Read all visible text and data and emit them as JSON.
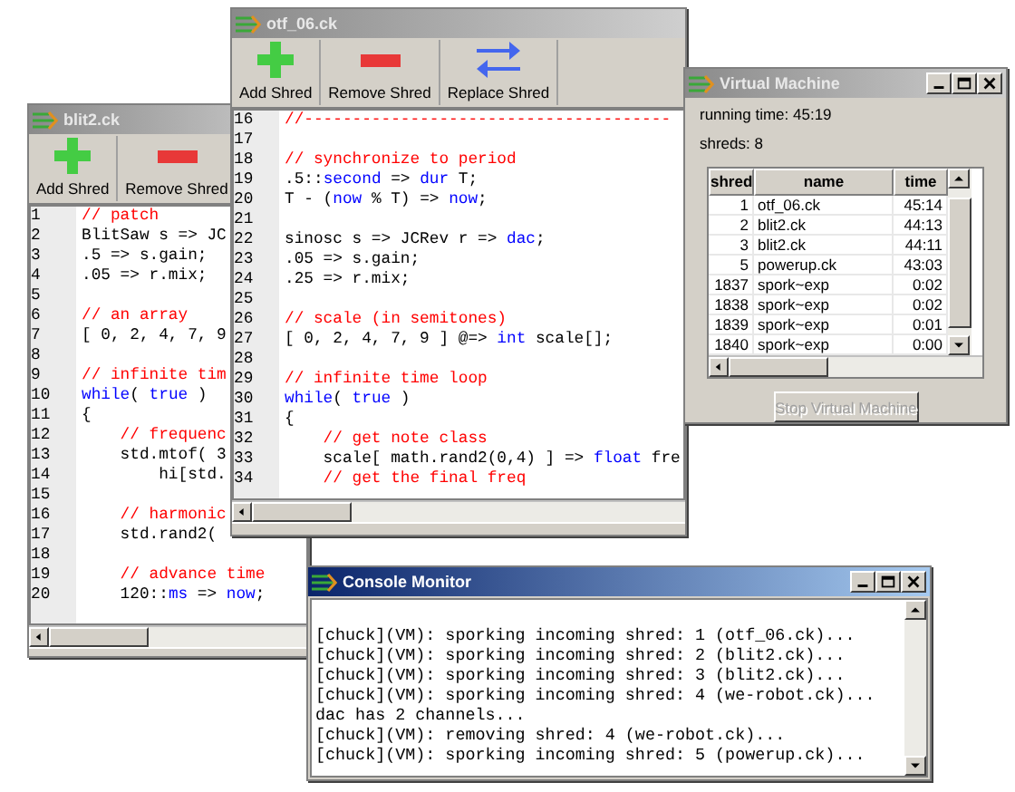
{
  "editor_windows": [
    {
      "title": "blit2.ck",
      "active": false,
      "toolbar": [
        {
          "label": "Add Shred",
          "kind": "add"
        },
        {
          "label": "Remove Shred",
          "kind": "remove"
        }
      ],
      "lines": [
        {
          "num": "1",
          "tokens": [
            {
              "text": "// patch",
              "kind": "comment"
            }
          ]
        },
        {
          "num": "2",
          "tokens": [
            {
              "text": "BlitSaw s => JC",
              "kind": "plain"
            }
          ]
        },
        {
          "num": "3",
          "tokens": [
            {
              "text": ".5 => s.gain;",
              "kind": "plain"
            }
          ]
        },
        {
          "num": "4",
          "tokens": [
            {
              "text": ".05 => r.mix;",
              "kind": "plain"
            }
          ]
        },
        {
          "num": "5"
        },
        {
          "num": "6",
          "tokens": [
            {
              "text": "// an array",
              "kind": "comment"
            }
          ]
        },
        {
          "num": "7",
          "tokens": [
            {
              "text": "[ 0, 2, 4, 7, 9",
              "kind": "plain"
            }
          ]
        },
        {
          "num": "8"
        },
        {
          "num": "9",
          "tokens": [
            {
              "text": "// infinite tim",
              "kind": "comment"
            }
          ]
        },
        {
          "num": "10",
          "tokens": [
            {
              "text": "while",
              "kind": "keyword"
            },
            {
              "text": "( ",
              "kind": "plain"
            },
            {
              "text": "true",
              "kind": "keyword"
            },
            {
              "text": " )",
              "kind": "plain"
            }
          ]
        },
        {
          "num": "11",
          "tokens": [
            {
              "text": "{",
              "kind": "plain"
            }
          ]
        },
        {
          "num": "12",
          "tokens": [
            {
              "text": "    // frequenc",
              "kind": "comment"
            }
          ]
        },
        {
          "num": "13",
          "tokens": [
            {
              "text": "    std.mtof( 3",
              "kind": "plain"
            }
          ]
        },
        {
          "num": "14",
          "tokens": [
            {
              "text": "        hi[std.",
              "kind": "plain"
            }
          ]
        },
        {
          "num": "15"
        },
        {
          "num": "16",
          "tokens": [
            {
              "text": "    // harmonic",
              "kind": "comment"
            }
          ]
        },
        {
          "num": "17",
          "tokens": [
            {
              "text": "    std.rand2(",
              "kind": "plain"
            }
          ]
        },
        {
          "num": "18"
        },
        {
          "num": "19",
          "tokens": [
            {
              "text": "    // advance time",
              "kind": "comment"
            }
          ]
        },
        {
          "num": "20",
          "tokens": [
            {
              "text": "    120::",
              "kind": "plain"
            },
            {
              "text": "ms",
              "kind": "keyword"
            },
            {
              "text": " => ",
              "kind": "plain"
            },
            {
              "text": "now",
              "kind": "keyword"
            },
            {
              "text": ";",
              "kind": "plain"
            }
          ]
        }
      ]
    },
    {
      "title": "otf_06.ck",
      "active": false,
      "toolbar": [
        {
          "label": "Add Shred",
          "kind": "add"
        },
        {
          "label": "Remove Shred",
          "kind": "remove"
        },
        {
          "label": "Replace Shred",
          "kind": "replace"
        }
      ],
      "lines": [
        {
          "num": "16",
          "tokens": [
            {
              "text": "//--------------------------------------",
              "kind": "comment"
            }
          ]
        },
        {
          "num": "17"
        },
        {
          "num": "18",
          "tokens": [
            {
              "text": "// synchronize to period",
              "kind": "comment"
            }
          ]
        },
        {
          "num": "19",
          "tokens": [
            {
              "text": ".5::",
              "kind": "plain"
            },
            {
              "text": "second",
              "kind": "keyword"
            },
            {
              "text": " => ",
              "kind": "plain"
            },
            {
              "text": "dur",
              "kind": "keyword"
            },
            {
              "text": " T;",
              "kind": "plain"
            }
          ]
        },
        {
          "num": "20",
          "tokens": [
            {
              "text": "T - (",
              "kind": "plain"
            },
            {
              "text": "now",
              "kind": "keyword"
            },
            {
              "text": " % T) => ",
              "kind": "plain"
            },
            {
              "text": "now",
              "kind": "keyword"
            },
            {
              "text": ";",
              "kind": "plain"
            }
          ]
        },
        {
          "num": "21"
        },
        {
          "num": "22",
          "tokens": [
            {
              "text": "sinosc s => JCRev r => ",
              "kind": "plain"
            },
            {
              "text": "dac",
              "kind": "keyword"
            },
            {
              "text": ";",
              "kind": "plain"
            }
          ]
        },
        {
          "num": "23",
          "tokens": [
            {
              "text": ".05 => s.gain;",
              "kind": "plain"
            }
          ]
        },
        {
          "num": "24",
          "tokens": [
            {
              "text": ".25 => r.mix;",
              "kind": "plain"
            }
          ]
        },
        {
          "num": "25"
        },
        {
          "num": "26",
          "tokens": [
            {
              "text": "// scale (in semitones)",
              "kind": "comment"
            }
          ]
        },
        {
          "num": "27",
          "tokens": [
            {
              "text": "[ 0, 2, 4, 7, 9 ] @=> ",
              "kind": "plain"
            },
            {
              "text": "int",
              "kind": "keyword"
            },
            {
              "text": " scale[];",
              "kind": "plain"
            }
          ]
        },
        {
          "num": "28"
        },
        {
          "num": "29",
          "tokens": [
            {
              "text": "// infinite time loop",
              "kind": "comment"
            }
          ]
        },
        {
          "num": "30",
          "tokens": [
            {
              "text": "while",
              "kind": "keyword"
            },
            {
              "text": "( ",
              "kind": "plain"
            },
            {
              "text": "true",
              "kind": "keyword"
            },
            {
              "text": " )",
              "kind": "plain"
            }
          ]
        },
        {
          "num": "31",
          "tokens": [
            {
              "text": "{",
              "kind": "plain"
            }
          ]
        },
        {
          "num": "32",
          "tokens": [
            {
              "text": "    // get note class",
              "kind": "comment"
            }
          ]
        },
        {
          "num": "33",
          "tokens": [
            {
              "text": "    scale[ math.rand2(0,4) ] => ",
              "kind": "plain"
            },
            {
              "text": "float",
              "kind": "keyword"
            },
            {
              "text": " fre",
              "kind": "plain"
            }
          ]
        },
        {
          "num": "34",
          "tokens": [
            {
              "text": "    // get the final freq",
              "kind": "comment"
            }
          ]
        }
      ]
    }
  ],
  "vm_window": {
    "title": "Virtual Machine",
    "active": false,
    "running_time": "running time: 45:19",
    "shreds": "shreds: 8",
    "table": {
      "columns": [
        "shred",
        "name",
        "time"
      ],
      "rows": [
        [
          "1",
          "otf_06.ck",
          "45:14"
        ],
        [
          "2",
          "blit2.ck",
          "44:13"
        ],
        [
          "3",
          "blit2.ck",
          "44:11"
        ],
        [
          "5",
          "powerup.ck",
          "43:03"
        ],
        [
          "1837",
          "spork~exp",
          "0:02"
        ],
        [
          "1838",
          "spork~exp",
          "0:02"
        ],
        [
          "1839",
          "spork~exp",
          "0:01"
        ],
        [
          "1840",
          "spork~exp",
          "0:00"
        ]
      ]
    },
    "button": {
      "label": "Stop Virtual Machine",
      "disabled": true
    }
  },
  "console_window": {
    "title": "Console Monitor",
    "active": true,
    "lines": [
      "[chuck](VM): sporking incoming shred: 1 (otf_06.ck)...",
      "[chuck](VM): sporking incoming shred: 2 (blit2.ck)...",
      "[chuck](VM): sporking incoming shred: 3 (blit2.ck)...",
      "[chuck](VM): sporking incoming shred: 4 (we-robot.ck)...",
      "dac has 2 channels...",
      "[chuck](VM): removing shred: 4 (we-robot.ck)...",
      "[chuck](VM): sporking incoming shred: 5 (powerup.ck)..."
    ]
  }
}
